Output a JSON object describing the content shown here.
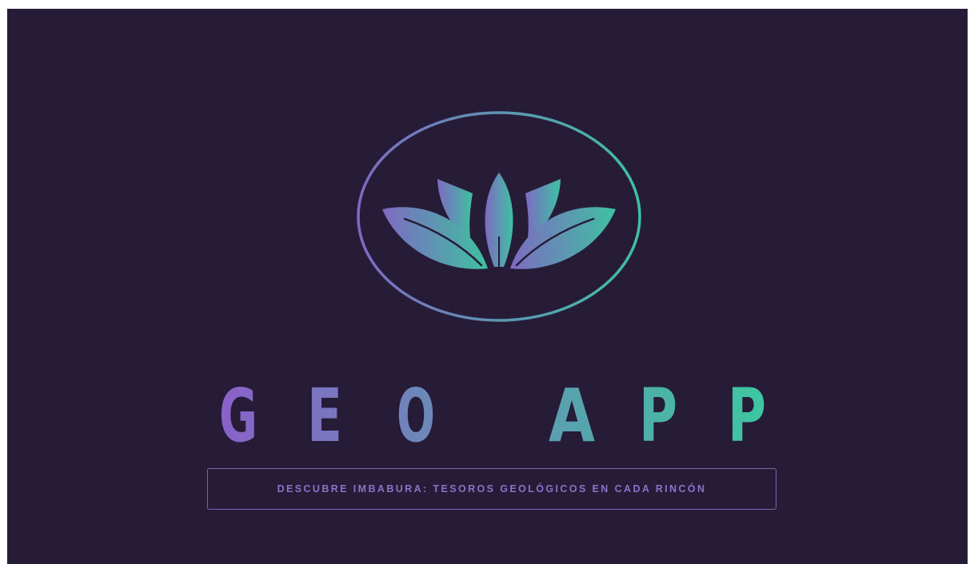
{
  "brand": {
    "word1_letters": [
      "G",
      "E",
      "O"
    ],
    "word2_letters": [
      "A",
      "P",
      "P"
    ],
    "tagline": "DESCUBRE IMBABURA: TESOROS GEOLÓGICOS EN CADA RINCÓN"
  },
  "logo": {
    "icon": "lotus-icon"
  },
  "colors": {
    "background": "#261c38",
    "gradient_start": "#8a60c8",
    "gradient_end": "#3cc8a0",
    "tagline_text": "#8a72c8",
    "tagline_border": "#7c64b4"
  }
}
